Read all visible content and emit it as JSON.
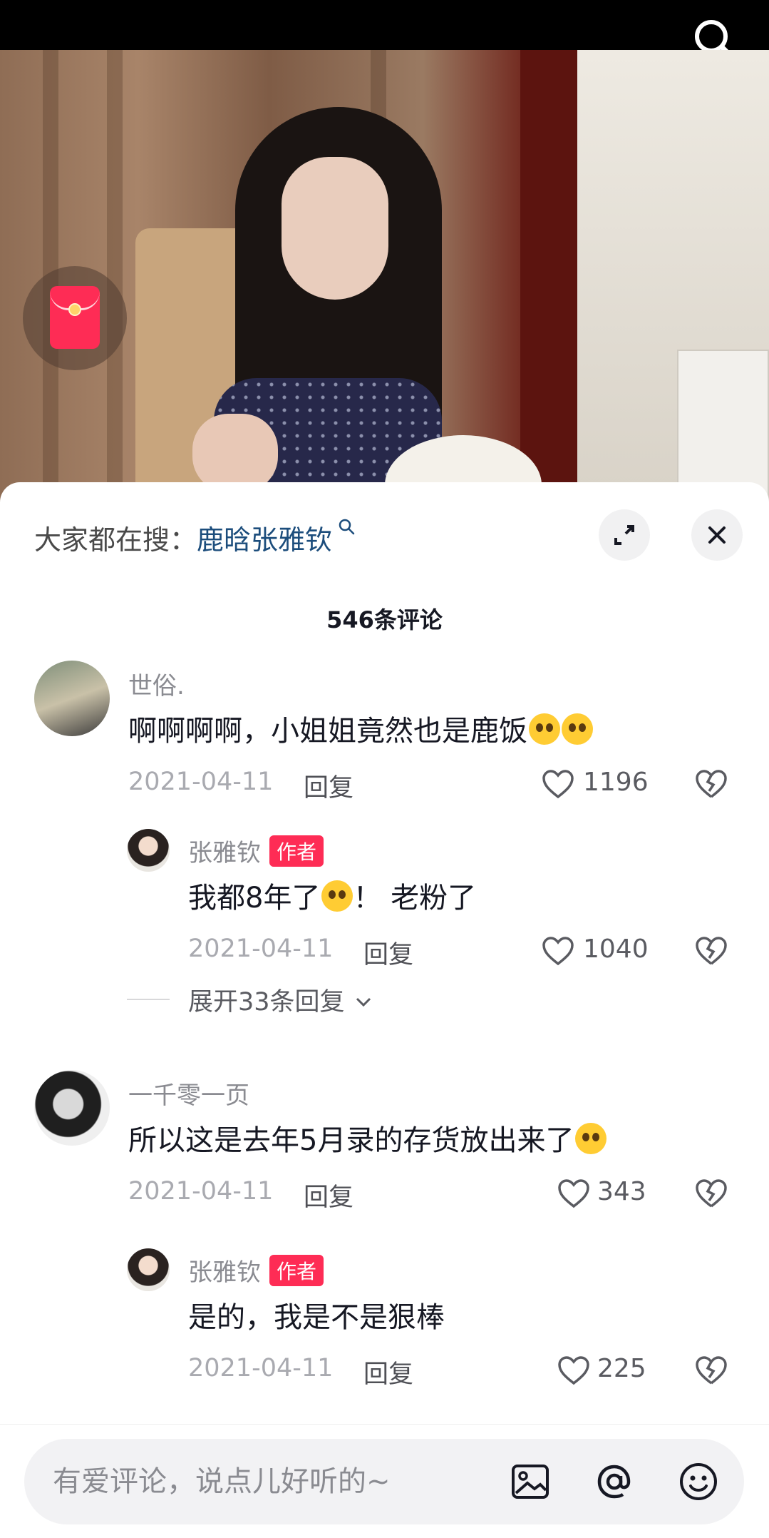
{
  "video": {
    "red_packet_icon": "red-envelope-icon"
  },
  "header": {
    "trending_prefix": "大家都在搜：",
    "trending_keyword": "鹿晗张雅钦",
    "search_icon": "search-icon"
  },
  "comments_count_label": "546条评论",
  "comments": [
    {
      "user": "世俗.",
      "text": "啊啊啊啊，小姐姐竟然也是鹿饭",
      "date": "2021-04-11",
      "reply_label": "回复",
      "likes": "1196",
      "replies": [
        {
          "user": "张雅钦",
          "badge": "作者",
          "text_before": "我都8年了",
          "text_after": "！ 老粉了",
          "date": "2021-04-11",
          "reply_label": "回复",
          "likes": "1040"
        }
      ],
      "expand_label": "展开33条回复"
    },
    {
      "user": "一千零一页",
      "text": "所以这是去年5月录的存货放出来了",
      "date": "2021-04-11",
      "reply_label": "回复",
      "likes": "343",
      "replies": [
        {
          "user": "张雅钦",
          "badge": "作者",
          "text": "是的，我是不是狠棒",
          "date": "2021-04-11",
          "reply_label": "回复",
          "likes": "225"
        }
      ]
    }
  ],
  "input": {
    "placeholder": "有爱评论，说点儿好听的~"
  },
  "colors": {
    "accent": "#fe2c55",
    "keyword": "#1c4d7c"
  }
}
